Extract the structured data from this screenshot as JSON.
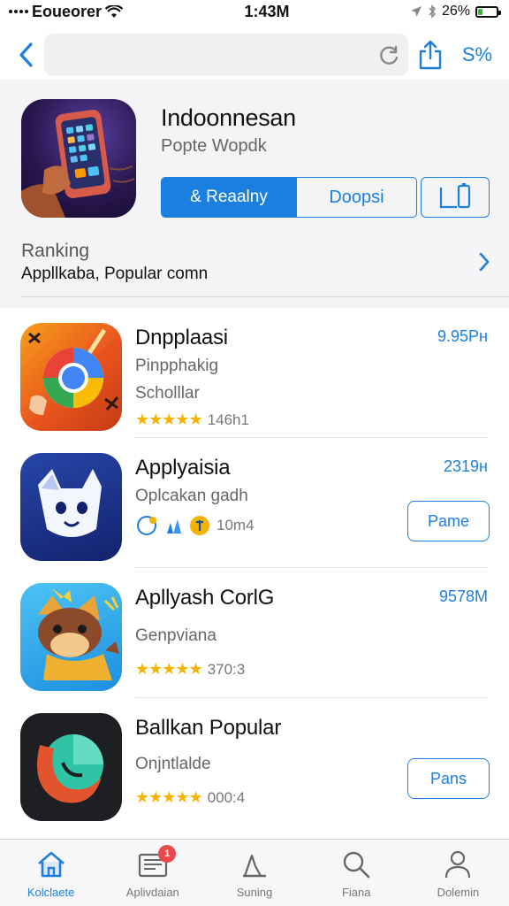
{
  "status_bar": {
    "carrier": "Eoueorer",
    "time": "1:43M",
    "battery": "26%",
    "battery_level": 0.26
  },
  "nav": {
    "right_label": "S%"
  },
  "app": {
    "title": "Indoonnesan",
    "subtitle": "Popte Wopdk",
    "primary_button": "& Reaalny",
    "secondary_button": "Doopsi",
    "ranking_label": "Ranking",
    "ranking_text": "Appllkaba, Popular comn"
  },
  "list": [
    {
      "title": "Dnpplaasi",
      "line1": "Pinpphakig",
      "line2": "Scholllar",
      "rating": "★★★★★",
      "meta": "146h1",
      "size": "9.95Pн",
      "button": null
    },
    {
      "title": "Applyaisia",
      "line1": "Oplcakan gadh",
      "line2": "",
      "rating": "",
      "meta": "10m4",
      "size": "2319н",
      "button": "Pame"
    },
    {
      "title": "Apllyash CorlG",
      "line1": "Genpviana",
      "line2": "",
      "rating": "★★★★★",
      "meta": "370:3",
      "size": "9578M",
      "button": null
    },
    {
      "title": "Ballkan Popular",
      "line1": "Onjntlalde",
      "line2": "",
      "rating": "★★★★★",
      "meta": "000:4",
      "size": "",
      "button": "Pans"
    }
  ],
  "tabs": [
    {
      "label": "Kolclaete",
      "icon": "home-icon",
      "active": true
    },
    {
      "label": "Aplivdaian",
      "icon": "news-icon",
      "active": false,
      "badge": "1"
    },
    {
      "label": "Suning",
      "icon": "chart-icon",
      "active": false
    },
    {
      "label": "Fiana",
      "icon": "search-icon",
      "active": false
    },
    {
      "label": "Dolemin",
      "icon": "person-icon",
      "active": false
    }
  ],
  "colors": {
    "accent": "#1c7fe0",
    "star": "#f5b301",
    "badge": "#e84a4a"
  }
}
